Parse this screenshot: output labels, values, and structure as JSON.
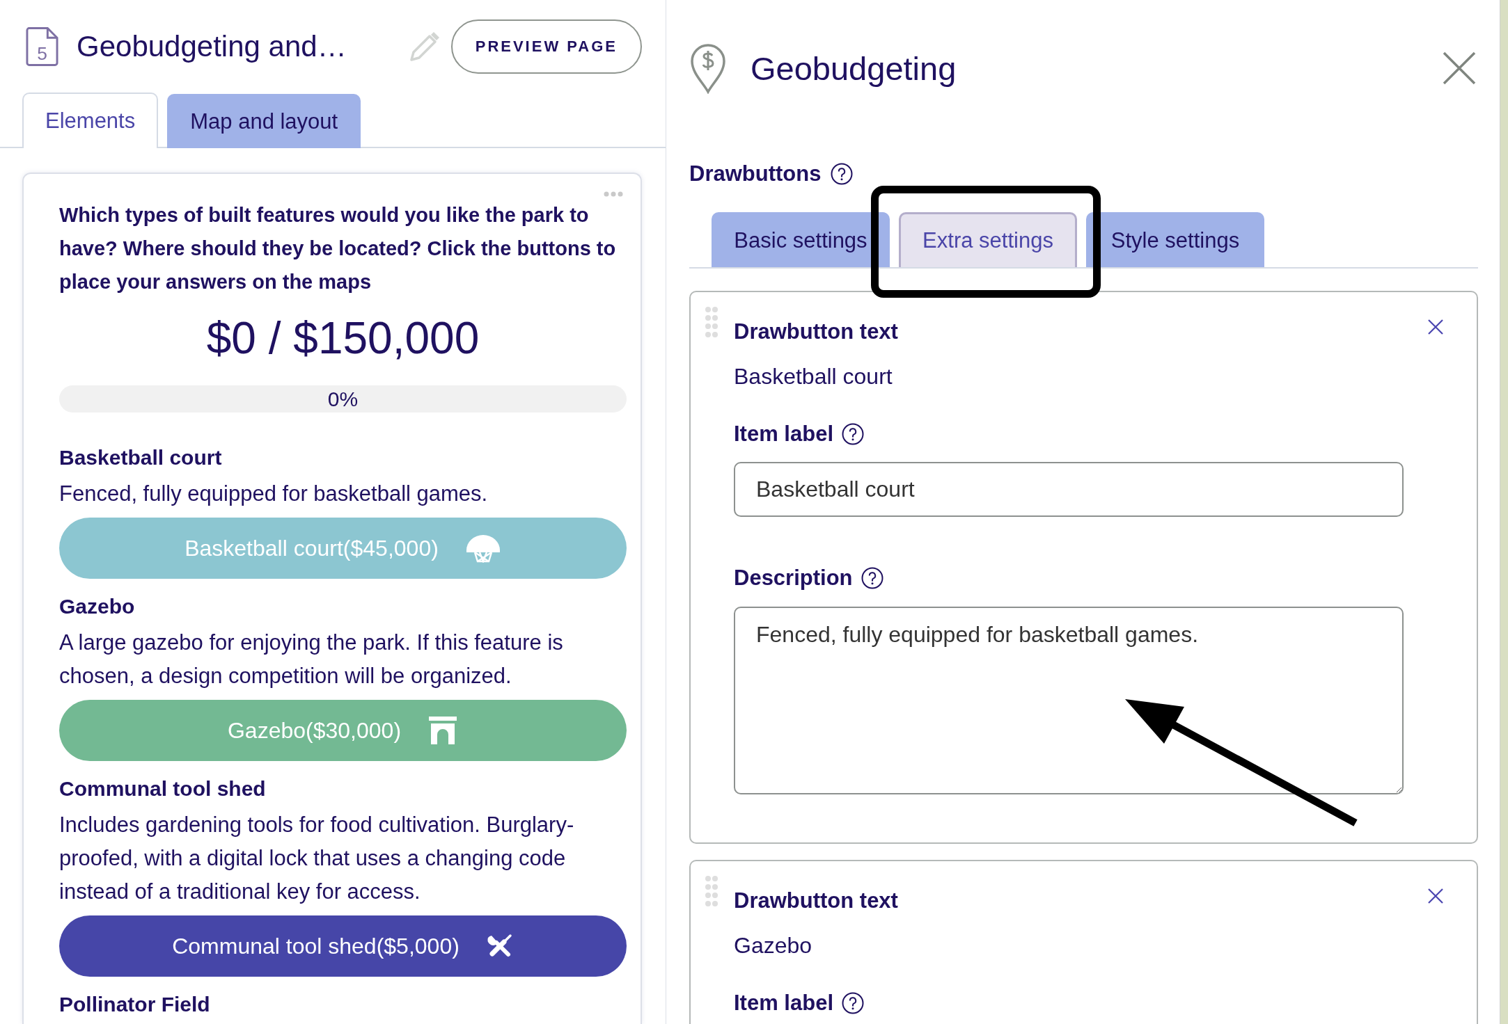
{
  "editor": {
    "page_number": "5",
    "title": "Geobudgeting and…",
    "preview_button": "PREVIEW PAGE",
    "tabs": [
      {
        "label": "Elements",
        "selected": true
      },
      {
        "label": "Map and layout",
        "selected": false
      }
    ]
  },
  "question_card": {
    "question": "Which types of built features would you like the park to have? Where should they be located? Click the buttons to place your answers on the maps",
    "budget": "$0 / $150,000",
    "progress": {
      "level": 0,
      "reading": "0%"
    },
    "items": [
      {
        "title": "Basketball court",
        "description": "Fenced, fully equipped for basketball games.",
        "button": "Basketball court($45,000)",
        "kind": "basketball",
        "color": "#8cc6d1"
      },
      {
        "title": "Gazebo",
        "description": "A large gazebo for enjoying the park. If this feature is chosen, a design competition will be organized.",
        "button": "Gazebo($30,000)",
        "kind": "gazebo",
        "color": "#73b993"
      },
      {
        "title": "Communal tool shed",
        "description": "Includes gardening tools for food cultivation. Burglary-proofed, with a digital lock that uses a changing code instead of a traditional key for access.",
        "button": "Communal tool shed($5,000)",
        "kind": "toolshed",
        "color": "#4646a8"
      },
      {
        "title": "Pollinator Field"
      }
    ]
  },
  "settings_panel": {
    "title": "Geobudgeting",
    "section_label": "Drawbuttons",
    "tabs": [
      {
        "label": "Basic settings",
        "selected": false
      },
      {
        "label": "Extra settings",
        "selected": true
      },
      {
        "label": "Style settings",
        "selected": false
      }
    ],
    "drawbuttons": [
      {
        "text_label": "Drawbutton text",
        "text": "Basketball court",
        "fields": [
          {
            "label": "Item label",
            "kind": "input",
            "value": "Basketball court"
          },
          {
            "label": "Description",
            "kind": "textarea",
            "value": "Fenced, fully equipped for basketball games."
          }
        ]
      },
      {
        "text_label": "Drawbutton text",
        "text": "Gazebo",
        "fields": [
          {
            "label": "Item label"
          }
        ]
      }
    ]
  }
}
